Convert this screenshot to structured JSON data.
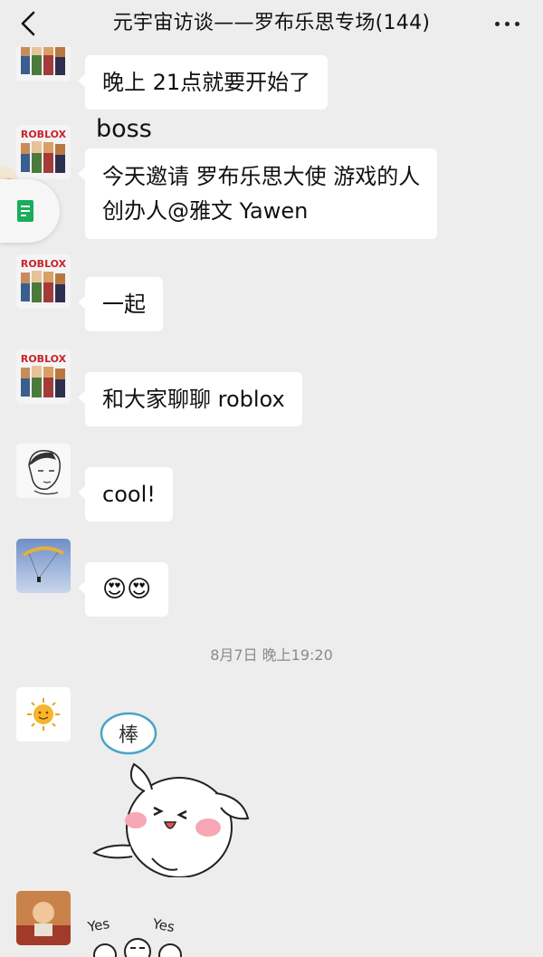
{
  "header": {
    "title": "元宇宙访谈——罗布乐思专场(144)"
  },
  "messages": [
    {
      "text": "晚上 21点就要开始了"
    },
    {
      "sender": "boss",
      "text_line1": "今天邀请 罗布乐思大使 游戏的人",
      "text_line2": "创办人@雅文 Yawen"
    },
    {
      "text": "一起"
    },
    {
      "text": "和大家聊聊 roblox"
    },
    {
      "text": "cool!"
    },
    {
      "text": "😍😍"
    }
  ],
  "timestamp": "8月7日 晚上19:20",
  "avatars": {
    "roblox_label": "ROBLOX"
  },
  "stickers": {
    "bang_char": "棒",
    "yes_left": "Yes",
    "yes_right": "Yes"
  },
  "colors": {
    "background": "#ededed",
    "bubble": "#ffffff",
    "doc_green": "#1aad5a"
  }
}
